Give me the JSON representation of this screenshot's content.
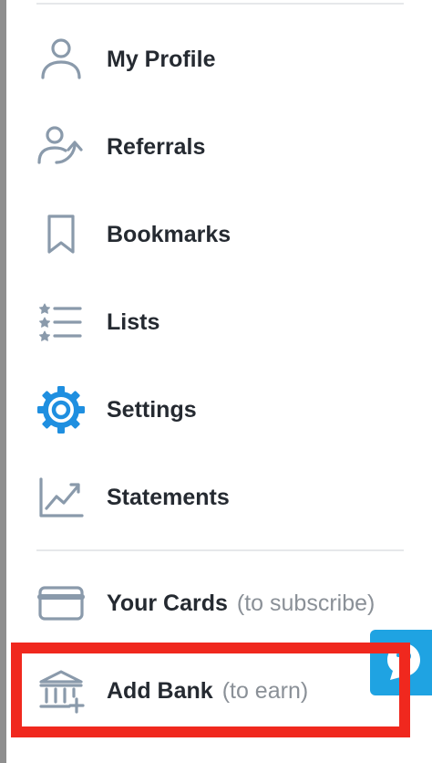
{
  "menu": {
    "items": [
      {
        "id": "my-profile",
        "label": "My Profile",
        "sub": "",
        "icon": "user-icon"
      },
      {
        "id": "referrals",
        "label": "Referrals",
        "sub": "",
        "icon": "referral-icon"
      },
      {
        "id": "bookmarks",
        "label": "Bookmarks",
        "sub": "",
        "icon": "bookmark-icon"
      },
      {
        "id": "lists",
        "label": "Lists",
        "sub": "",
        "icon": "list-icon"
      },
      {
        "id": "settings",
        "label": "Settings",
        "sub": "",
        "icon": "gear-icon"
      },
      {
        "id": "statements",
        "label": "Statements",
        "sub": "",
        "icon": "chart-icon"
      },
      {
        "id": "your-cards",
        "label": "Your Cards",
        "sub": "(to subscribe)",
        "icon": "card-icon"
      },
      {
        "id": "add-bank",
        "label": "Add Bank",
        "sub": "(to earn)",
        "icon": "bank-icon"
      }
    ]
  },
  "help": {
    "icon": "help-chat-icon"
  },
  "colors": {
    "text": "#252a31",
    "muted": "#8a9097",
    "icon": "#8a9aab",
    "active": "#1f8fe0",
    "highlight": "#f0281e",
    "help_fab": "#1fa3e2"
  }
}
